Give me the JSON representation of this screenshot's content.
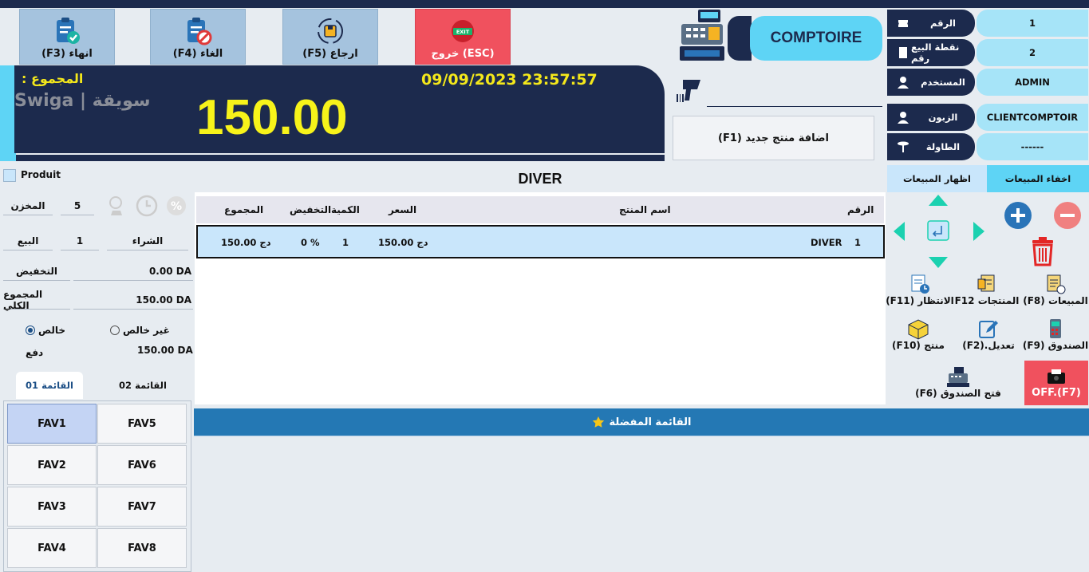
{
  "toolbar": {
    "finish": "(F3) انهاء",
    "cancel": "(F4) الغاء",
    "refund": "(F5) ارجاع",
    "exit": "خروج (ESC)",
    "exit_icon_text": "EXIT"
  },
  "banner": {
    "total_label": ": المجموع",
    "datetime": "09/09/2023  23:57:57",
    "total": "150.00",
    "watermark": "Swiga | سويقة"
  },
  "counter": {
    "title": "COMPTOIRE",
    "add_product": "(F1) اضافة منتج جديد"
  },
  "info": {
    "number_label": "الرقم",
    "number_value": "1",
    "pos_label": "نقطة البيع رقم",
    "pos_value": "2",
    "user_label": "المستخدم",
    "user_value": "ADMIN",
    "customer_label": "الزبون",
    "customer_value": "CLIENTCOMPTOIR",
    "table_label": "الطاولة",
    "table_value": "------"
  },
  "sales_tabs": {
    "show": "اظهار المبيعات",
    "hide": "اخفاء المبيعات"
  },
  "product_panel": {
    "header": "Produit",
    "stock_label": "المخزن",
    "stock_value": "5",
    "buy_label": "الشراء",
    "sell_label": "البيع",
    "sell_value": "1",
    "discount_label": "التخفيض",
    "discount_value": "0.00 DA",
    "grand_total_label": "المجموع الكلي",
    "grand_total_value": "150.00 DA",
    "net_label": "خالص",
    "not_net_label": "غير خالص",
    "pay_label": "دفع",
    "pay_value": "150.00 DA"
  },
  "ticket": {
    "title": "DIVER",
    "columns": {
      "num": "الرقم",
      "name": "اسم المنتج",
      "price": "السعر",
      "qty": "الكمية",
      "discount": "التخفيض",
      "total": "المجموع"
    },
    "rows": [
      {
        "num": "1",
        "name": "DIVER",
        "price": "150.00 دج",
        "qty": "1",
        "discount": "0 %",
        "total": "150.00 دج"
      }
    ]
  },
  "actions": {
    "sales": "(F8) المبيعات",
    "products": "F12 المنتجات",
    "waiting": "(F11) الانتظار",
    "cashbox": "(F9) الصندوق",
    "edit": "(F2).تعديل",
    "product": "(F10) منتج",
    "off": "OFF.(F7)",
    "open_cashbox": "(F6) فتح الصندوق"
  },
  "fav_tabs": {
    "list1": "القائمة 01",
    "list2": "القائمة 02"
  },
  "favorites": [
    "FAV1",
    "FAV5",
    "FAV2",
    "FAV6",
    "FAV3",
    "FAV7",
    "FAV4",
    "FAV8"
  ],
  "favorites_bar": "القائمة المفضلة",
  "colors": {
    "navy": "#1c2a4d",
    "cyan": "#5ed4f5",
    "yellow": "#f4e81b",
    "exit_red": "#f0515e",
    "fav_bar": "#2478b4",
    "icon_blue": "#2a74b8",
    "icon_green": "#1bb3a4"
  }
}
